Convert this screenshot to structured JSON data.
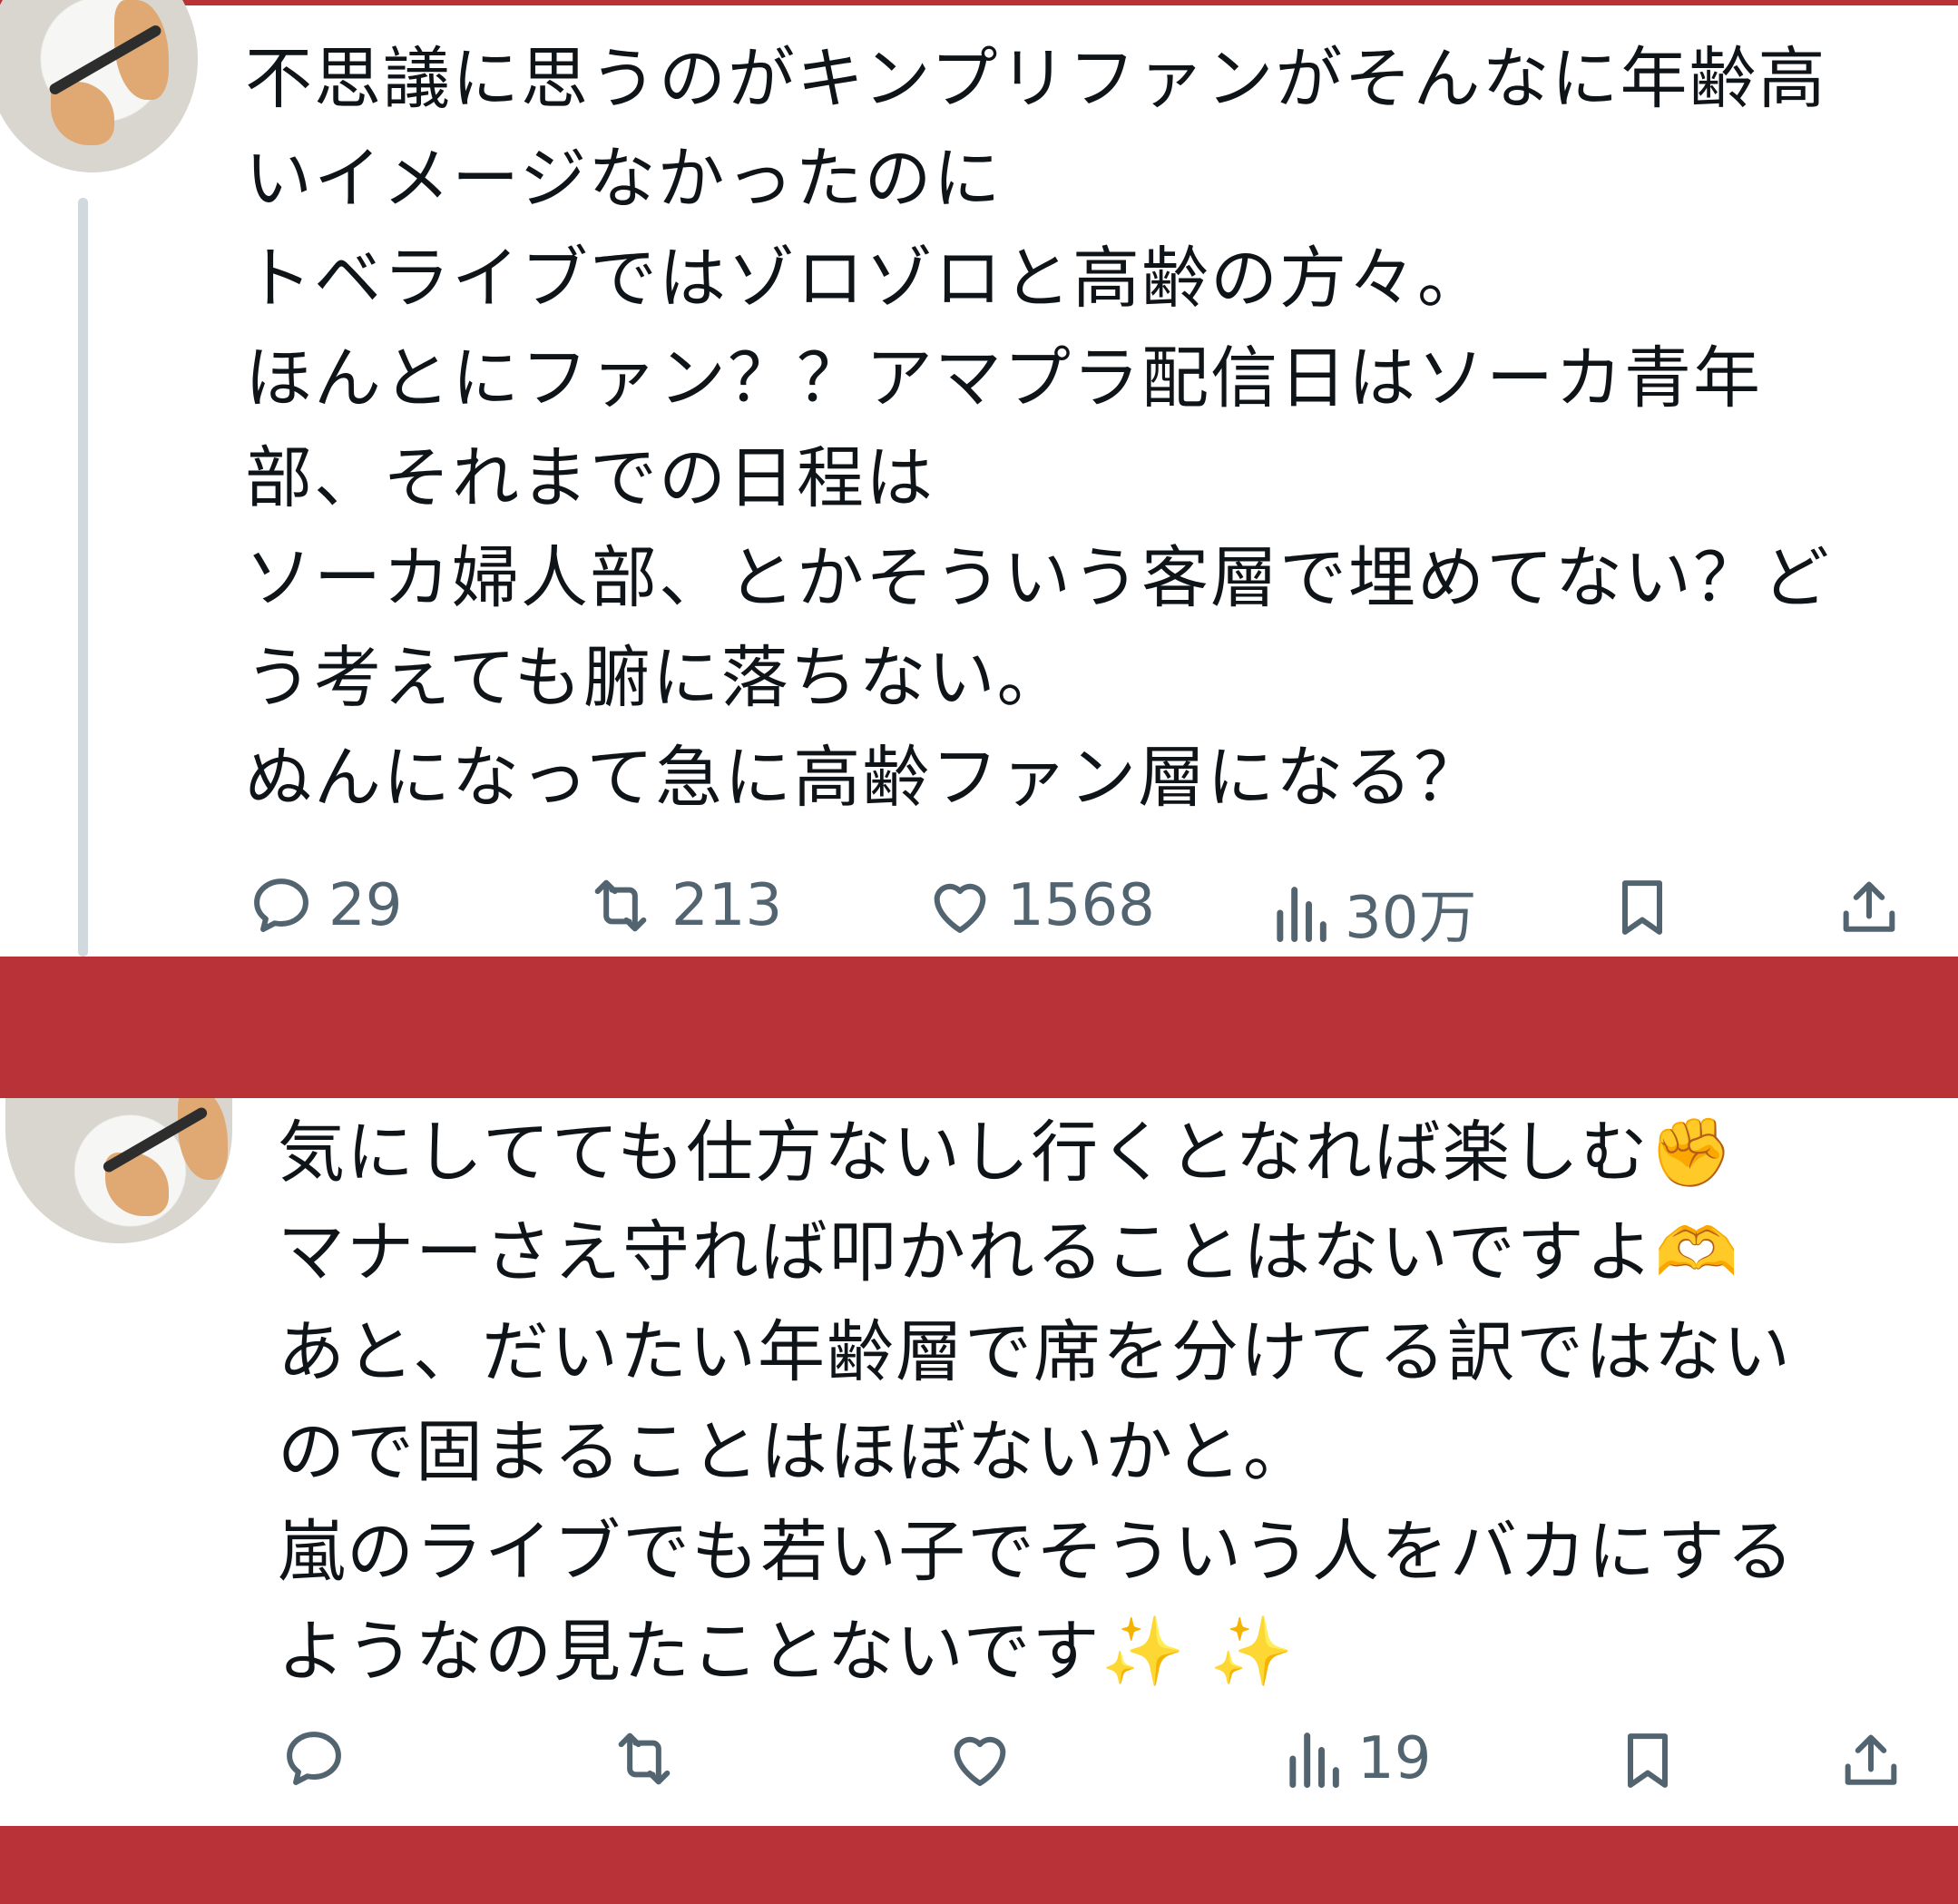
{
  "tweets": [
    {
      "text": "不思議に思うのがキンプリファンがそんなに年齢高\nいイメージなかったのに\nトベライブではゾロゾロと高齢の方々。\nほんとにファン？？アマプラ配信日はソーカ青年\n部、それまでの日程は\nソーカ婦人部、とかそういう客層で埋めてない？ど\nう考えても腑に落ちない。\nぬんになって急に高齢ファン層になる？",
      "reply_count": "29",
      "retweet_count": "213",
      "like_count": "1568",
      "view_count": "30万"
    },
    {
      "text": "気にしてても仕方ないし行くとなれば楽しむ✊\nマナーさえ守れば叩かれることはないですよ🫶\nあと、だいたい年齢層で席を分けてる訳ではない\nので固まることはほぼないかと。\n嵐のライブでも若い子でそういう人をバカにする\nようなの見たことないです✨ ✨",
      "reply_count": "",
      "retweet_count": "",
      "like_count": "",
      "view_count": "19"
    }
  ],
  "icons": {
    "reply": "reply-icon",
    "retweet": "retweet-icon",
    "like": "heart-icon",
    "views": "views-icon",
    "bookmark": "bookmark-icon",
    "share": "share-icon"
  },
  "colors": {
    "band": "#b83238",
    "icon_gray": "#536471",
    "text": "#0f1419"
  }
}
